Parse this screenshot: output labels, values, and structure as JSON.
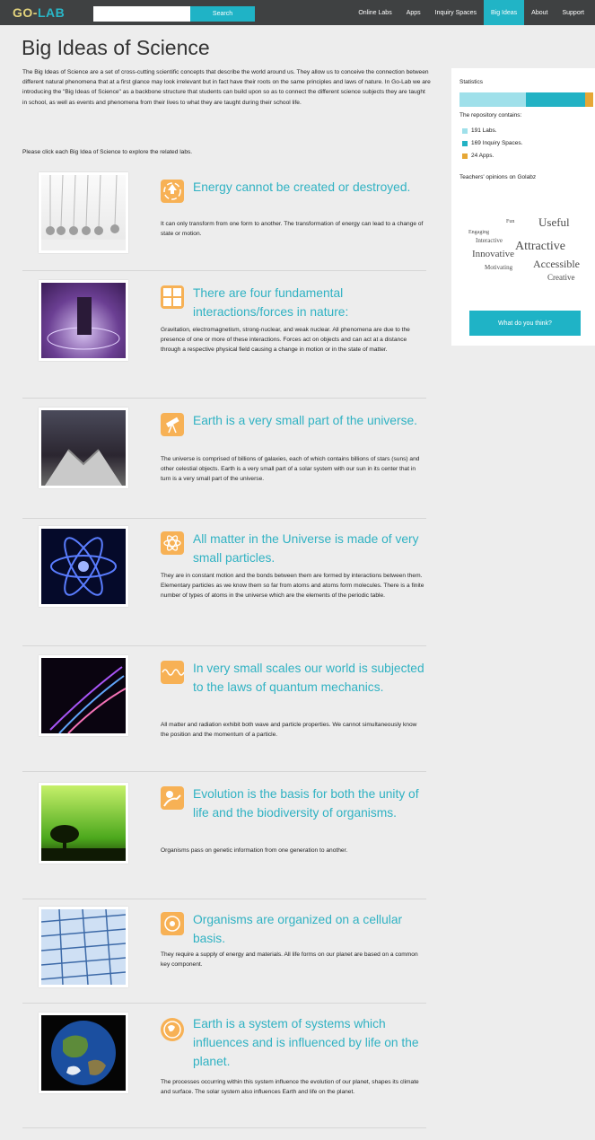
{
  "brand": {
    "part1": "GO-",
    "part2": "LAB"
  },
  "search": {
    "placeholder": "",
    "button": "Search"
  },
  "nav": [
    "Online Labs",
    "Apps",
    "Inquiry Spaces",
    "Big Ideas",
    "About",
    "Support"
  ],
  "nav_active": "Big Ideas",
  "page": {
    "title": "Big Ideas of Science",
    "intro": "The Big Ideas of Science are a set of cross-cutting scientific concepts that describe the world around us. They allow us to conceive the connection between different natural phenomena that at a first glance may look irrelevant but in fact have their roots on the same principles and laws of nature. In Go-Lab we are introducing the \"Big Ideas of Science\" as a backbone structure that students can build upon so as to connect the different science subjects they are taught in school, as well as events and phenomena from their lives to what they are taught during their school life.",
    "instruction": "Please click each Big Idea of Science to explore the related labs."
  },
  "ideas": [
    {
      "title": "Energy cannot be created or destroyed.",
      "description": "It can only transform from one form to another. The transformation of energy can lead to a change of state or motion.",
      "icon": "recycle-icon",
      "image": "newtons-cradle"
    },
    {
      "title": "There are four fundamental interactions/forces in nature:",
      "description": "Gravitation, electromagnetism, strong-nuclear, and weak nuclear. All phenomena are due to the presence of one or more of these interactions. Forces act on objects and can act at a distance through a respective physical field causing a change in motion or in the state of matter.",
      "icon": "forces-icon",
      "image": "monolith-field"
    },
    {
      "title": "Earth is a very small part of the universe.",
      "description": "The universe is comprised of billions of galaxies, each of which contains billions of stars (suns) and other celestial objects. Earth is a very small part of a solar system with our sun in its center that in turn is a very small part of the universe.",
      "icon": "telescope-icon",
      "image": "observatory"
    },
    {
      "title": "All matter in the Universe is made of very small particles.",
      "description": "They are in constant motion and the bonds between them are formed by interactions between them. Elementary particles as we know them so far from atoms and atoms form molecules. There is a finite number of types of atoms in the universe which are the elements of the periodic table.",
      "icon": "atom-icon",
      "image": "atom"
    },
    {
      "title": "In very small scales our world is subjected to the laws of quantum mechanics.",
      "description": "All matter and radiation exhibit both wave and particle properties. We cannot simultaneously know the position and the momentum of a particle.",
      "icon": "wave-icon",
      "image": "light-waves"
    },
    {
      "title": "Evolution is the basis for both the unity of life and the biodiversity of organisms.",
      "description": "Organisms pass on genetic information from one generation to another.",
      "icon": "evolution-icon",
      "image": "tree-silhouette"
    },
    {
      "title": "Organisms are organized on a cellular basis.",
      "description": "They require a supply of energy and materials. All life forms on our planet are based on a common key component.",
      "icon": "cell-icon",
      "image": "cells"
    },
    {
      "title": "Earth is a system of systems which influences and is influenced by life on the planet.",
      "description": "The processes occurring within this system influence the evolution of our planet, shapes its climate and surface. The solar system also influences Earth and life on the planet.",
      "icon": "earth-icon",
      "image": "earth"
    }
  ],
  "sidebar": {
    "heading": "Statistics",
    "contains": "The repository contains:",
    "stats": [
      {
        "label": "191 Labs.",
        "value": 191,
        "color": "#9fe0ea"
      },
      {
        "label": "169 Inquiry Spaces.",
        "value": 169,
        "color": "#22b2c4"
      },
      {
        "label": "24 Apps.",
        "value": 24,
        "color": "#e6a735"
      }
    ],
    "opinions_heading": "Teachers' opinions on Golabz",
    "cloud_words": [
      "Useful",
      "Attractive",
      "Innovative",
      "Accessible",
      "Creative",
      "Motivating",
      "Engaging",
      "Fun",
      "Interactive"
    ],
    "cta": "What do you think?"
  }
}
